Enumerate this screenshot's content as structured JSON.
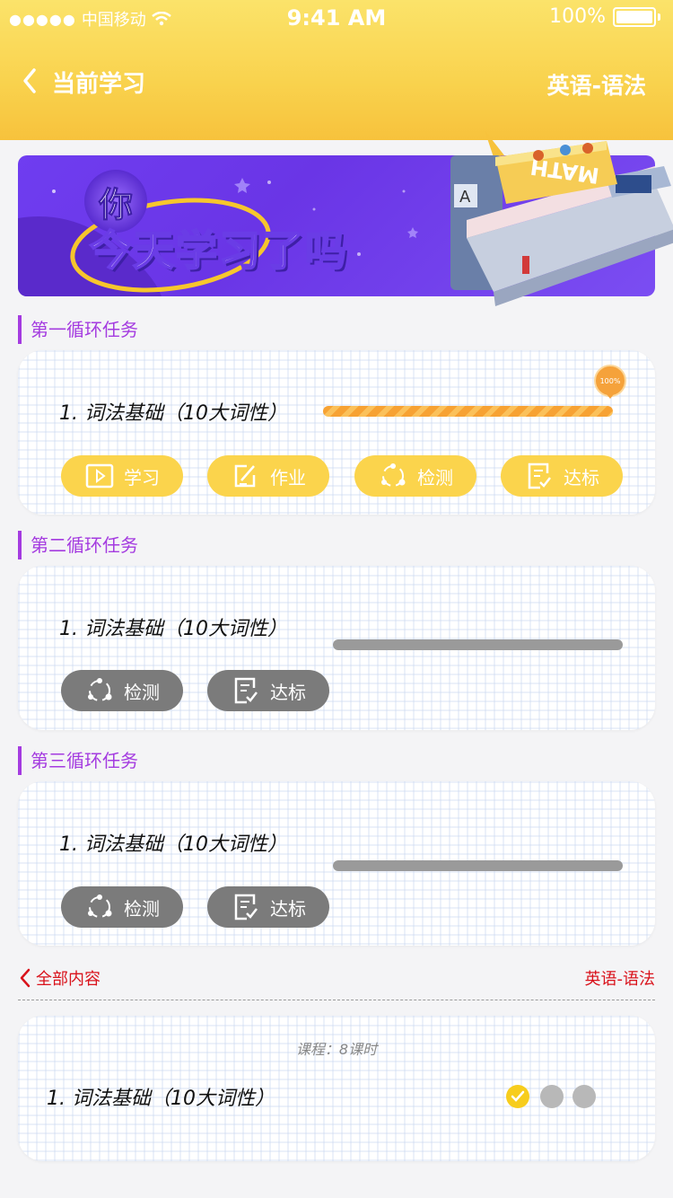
{
  "status_bar": {
    "carrier": "中国移动",
    "time": "9:41 AM",
    "battery": "100%"
  },
  "nav": {
    "title": "当前学习",
    "subject": "英语-语法"
  },
  "banner": {
    "you": "你",
    "slogan": "今天学习了吗",
    "book_label": "MATH"
  },
  "sections": [
    {
      "title": "第一循环任务",
      "item": "1. 词法基础（10大词性）",
      "progress": 100,
      "progress_label": "100%",
      "buttons": [
        "学习",
        "作业",
        "检测",
        "达标"
      ]
    },
    {
      "title": "第二循环任务",
      "item": "1. 词法基础（10大词性）",
      "buttons": [
        "检测",
        "达标"
      ]
    },
    {
      "title": "第三循环任务",
      "item": "1. 词法基础（10大词性）",
      "buttons": [
        "检测",
        "达标"
      ]
    }
  ],
  "all_content": {
    "label": "全部内容",
    "subject": "英语-语法"
  },
  "course_card": {
    "info": "课程：8课时",
    "item": "1. 词法基础（10大词性）",
    "status": [
      "done",
      "pending",
      "pending"
    ]
  },
  "colors": {
    "header": "#f9d24d",
    "accent": "#a43be0",
    "button_yellow": "#fbd44c",
    "button_gray": "#7b7b7b",
    "link_red": "#d9121b"
  }
}
